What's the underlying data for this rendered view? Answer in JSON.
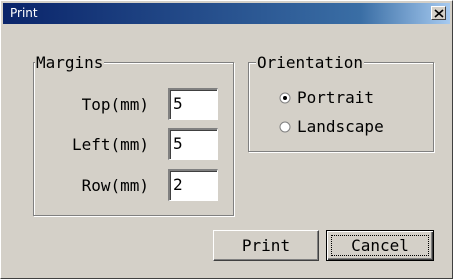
{
  "window": {
    "title": "Print",
    "close_icon": "close-icon"
  },
  "margins": {
    "legend": "Margins",
    "fields": [
      {
        "label": "Top(mm)",
        "value": "5"
      },
      {
        "label": "Left(mm)",
        "value": "5"
      },
      {
        "label": "Row(mm)",
        "value": "2"
      }
    ]
  },
  "orientation": {
    "legend": "Orientation",
    "options": [
      {
        "label": "Portrait",
        "selected": true
      },
      {
        "label": "Landscape",
        "selected": false
      }
    ]
  },
  "buttons": {
    "print_label": "Print",
    "cancel_label": "Cancel",
    "default_button": "cancel"
  },
  "colors": {
    "titlebar_start": "#0a246a",
    "titlebar_end": "#a6caf0",
    "face": "#d4d0c8"
  }
}
